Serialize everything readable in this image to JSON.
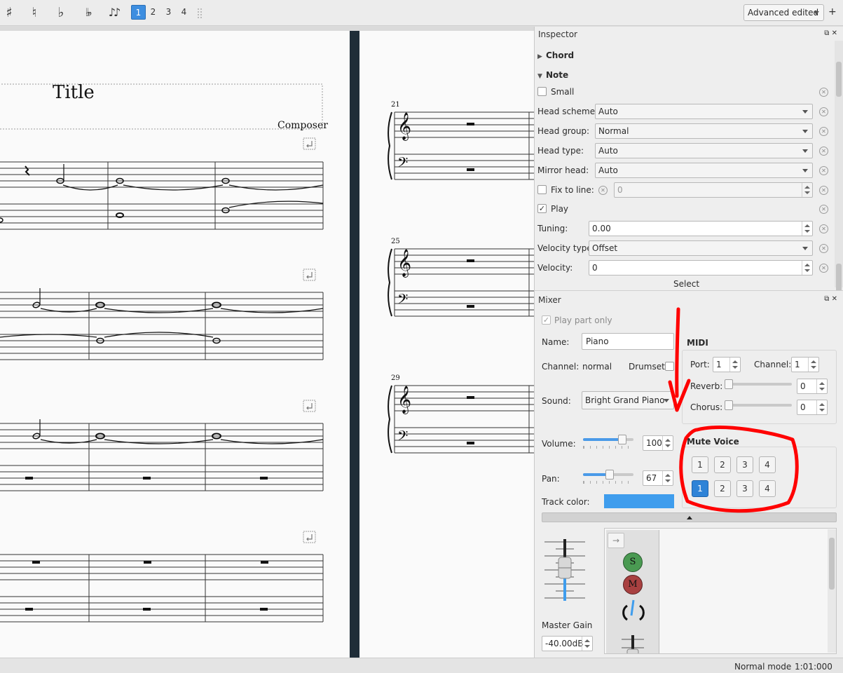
{
  "toolbar": {
    "accidentals": [
      {
        "name": "sharp",
        "glyph": "♯"
      },
      {
        "name": "natural",
        "glyph": "♮"
      },
      {
        "name": "flat",
        "glyph": "♭"
      },
      {
        "name": "double-flat",
        "glyph": "♭♭"
      },
      {
        "name": "voice-notes",
        "glyph": "♪♪"
      }
    ],
    "voices": [
      "1",
      "2",
      "3",
      "4"
    ],
    "active_voice": "1",
    "workspace": "Advanced edited",
    "add_workspace": "+"
  },
  "score": {
    "title": "Title",
    "composer": "Composer",
    "measure_numbers": [
      "21",
      "25",
      "29"
    ]
  },
  "inspector": {
    "title": "Inspector",
    "sections": {
      "chord": "Chord",
      "note": "Note"
    },
    "small_label": "Small",
    "head_scheme_label": "Head scheme:",
    "head_scheme_value": "Auto",
    "head_group_label": "Head group:",
    "head_group_value": "Normal",
    "head_type_label": "Head type:",
    "head_type_value": "Auto",
    "mirror_head_label": "Mirror head:",
    "mirror_head_value": "Auto",
    "fix_to_line_label": "Fix to line:",
    "fix_to_line_value": "0",
    "play_label": "Play",
    "tuning_label": "Tuning:",
    "tuning_value": "0.00",
    "velocity_type_label": "Velocity type:",
    "velocity_type_value": "Offset",
    "velocity_label": "Velocity:",
    "velocity_value": "0",
    "select_label": "Select"
  },
  "mixer": {
    "title": "Mixer",
    "play_part_only": "Play part only",
    "name_label": "Name:",
    "name_value": "Piano",
    "channel_label": "Channel:",
    "channel_value": "normal",
    "drumset_label": "Drumset",
    "sound_label": "Sound:",
    "sound_value": "Bright Grand Piano",
    "midi_title": "MIDI",
    "port_label": "Port:",
    "port_value": "1",
    "midi_channel_label": "Channel:",
    "midi_channel_value": "1",
    "reverb_label": "Reverb:",
    "reverb_value": "0",
    "chorus_label": "Chorus:",
    "chorus_value": "0",
    "volume_label": "Volume:",
    "volume_value": "100",
    "volume_level": 0.78,
    "pan_label": "Pan:",
    "pan_value": "67",
    "pan_level": 0.53,
    "track_color_label": "Track color:",
    "track_color": "#3f9ded",
    "mute_voice_title": "Mute Voice",
    "mute_voice_row1": [
      "1",
      "2",
      "3",
      "4"
    ],
    "mute_voice_row2": [
      "1",
      "2",
      "3",
      "4"
    ],
    "master_gain_label": "Master Gain",
    "master_gain_value": "-40.00dB",
    "solo_label": "S",
    "mute_label": "M"
  },
  "status": {
    "mode": "Normal mode",
    "position": "1:01:000"
  },
  "colors": {
    "accent": "#2f83d7",
    "annotation_red": "#ff0000",
    "page_background": "#fafafa",
    "page_gap": "#1f2d38"
  }
}
